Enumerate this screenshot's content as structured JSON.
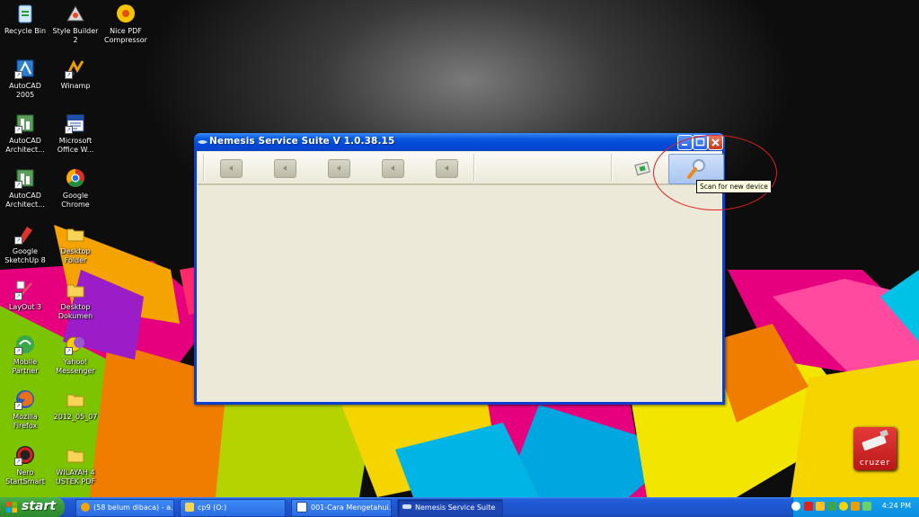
{
  "desktop": {
    "icons": [
      {
        "label": "Recycle Bin",
        "icon": "recycle-bin-icon"
      },
      {
        "label": "Style Builder 2",
        "icon": "style-builder-icon"
      },
      {
        "label": "Nice PDF Compressor",
        "icon": "pdf-compressor-icon"
      },
      {
        "label": "AutoCAD 2005",
        "icon": "autocad-icon"
      },
      {
        "label": "Winamp",
        "icon": "winamp-icon"
      },
      {
        "label": "AutoCAD Architect...",
        "icon": "autocad-architecture-icon"
      },
      {
        "label": "Microsoft Office W...",
        "icon": "word-icon"
      },
      {
        "label": "AutoCAD Architect...",
        "icon": "autocad-architecture-icon"
      },
      {
        "label": "Google Chrome",
        "icon": "chrome-icon"
      },
      {
        "label": "Google SketchUp 8",
        "icon": "sketchup-icon"
      },
      {
        "label": "Desktop Folder",
        "icon": "folder-icon"
      },
      {
        "label": "LayOut 3",
        "icon": "layout-icon"
      },
      {
        "label": "Desktop Dokumen",
        "icon": "folder-icon"
      },
      {
        "label": "Mobile Partner",
        "icon": "mobile-partner-icon"
      },
      {
        "label": "Yahoo! Messenger",
        "icon": "yahoo-messenger-icon"
      },
      {
        "label": "Mozilla Firefox",
        "icon": "firefox-icon"
      },
      {
        "label": "2012_05_07",
        "icon": "folder-icon"
      },
      {
        "label": "Nero StartSmart",
        "icon": "nero-icon"
      },
      {
        "label": "WILAYAH 4 USTEK PDF",
        "icon": "folder-icon"
      }
    ],
    "cruzer_label": "cruzer"
  },
  "window": {
    "title": "Nemesis Service Suite V 1.0.38.15",
    "tooltip": "Scan for new device"
  },
  "taskbar": {
    "start_label": "start",
    "tasks": [
      {
        "label": "(58 belum dibaca) - a...",
        "active": false
      },
      {
        "label": "cp9 (O:)",
        "active": false
      },
      {
        "label": "001-Cara Mengetahui...",
        "active": false
      },
      {
        "label": "Nemesis Service Suite",
        "active": true
      }
    ],
    "clock": "4:24 PM"
  },
  "colors": {
    "xp_blue": "#245edb",
    "start_green": "#3a9a3a",
    "window_face": "#ece9d8",
    "tooltip_bg": "#ffffe1",
    "annotation_red": "#e01e1e"
  }
}
